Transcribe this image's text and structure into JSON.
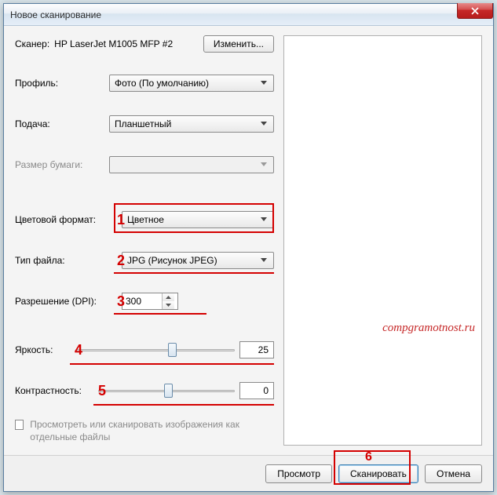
{
  "window": {
    "title": "Новое сканирование"
  },
  "scanner": {
    "label": "Сканер:",
    "name": "HP LaserJet M1005 MFP #2",
    "change_btn": "Изменить..."
  },
  "profile": {
    "label": "Профиль:",
    "value": "Фото (По умолчанию)"
  },
  "feed": {
    "label": "Подача:",
    "value": "Планшетный"
  },
  "paper": {
    "label": "Размер бумаги:",
    "value": ""
  },
  "color": {
    "label": "Цветовой формат:",
    "value": "Цветное"
  },
  "filetype": {
    "label": "Тип файла:",
    "value": "JPG (Рисунок JPEG)"
  },
  "dpi": {
    "label": "Разрешение (DPI):",
    "value": "300"
  },
  "brightness": {
    "label": "Яркость:",
    "value": "25"
  },
  "contrast": {
    "label": "Контрастность:",
    "value": "0"
  },
  "checkbox": {
    "label": "Просмотреть или сканировать изображения как отдельные файлы"
  },
  "footer": {
    "preview": "Просмотр",
    "scan": "Сканировать",
    "cancel": "Отмена"
  },
  "watermark": "compgramotnost.ru",
  "annotations": {
    "n1": "1",
    "n2": "2",
    "n3": "3",
    "n4": "4",
    "n5": "5",
    "n6": "6"
  }
}
